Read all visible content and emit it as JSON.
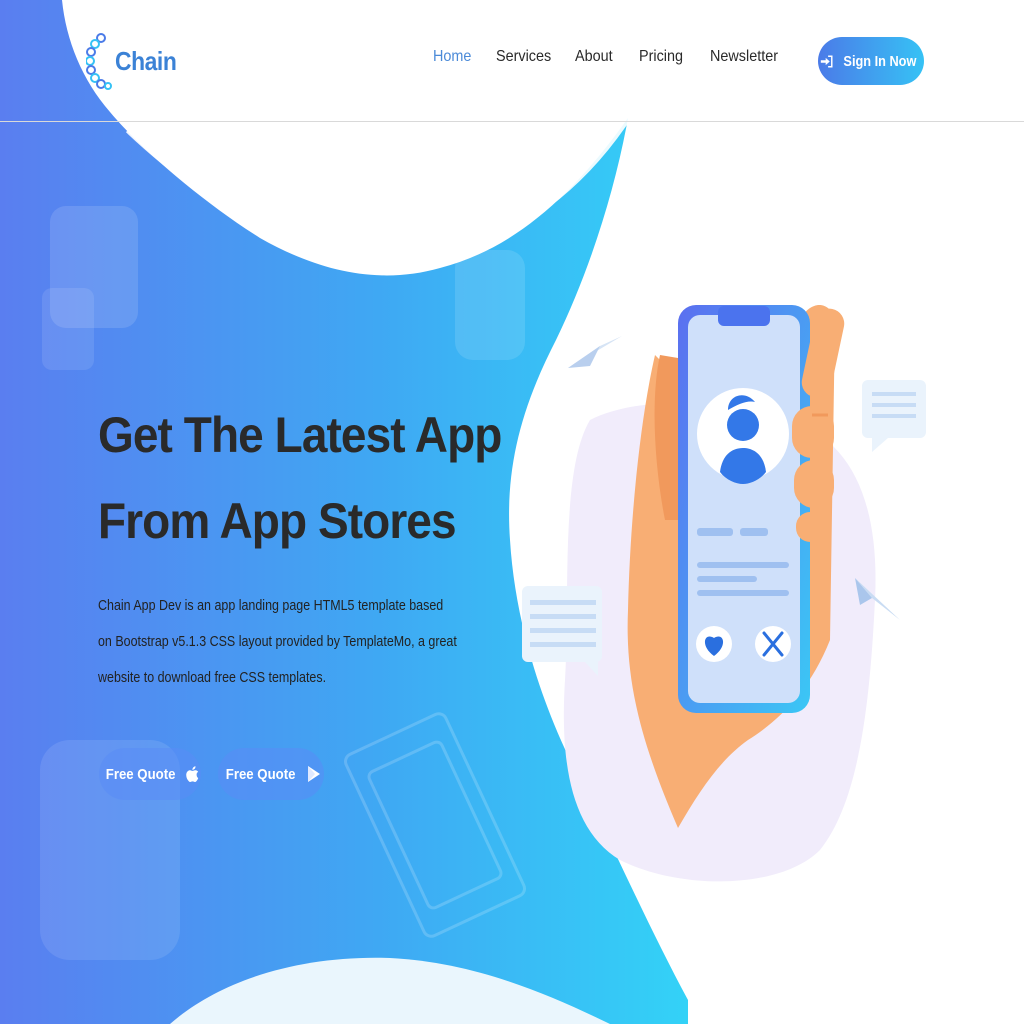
{
  "brand": {
    "name": "Chain"
  },
  "nav": {
    "items": [
      {
        "label": "Home",
        "active": true
      },
      {
        "label": "Services",
        "active": false
      },
      {
        "label": "About",
        "active": false
      },
      {
        "label": "Pricing",
        "active": false
      },
      {
        "label": "Newsletter",
        "active": false
      }
    ],
    "signin_label": "Sign In Now",
    "signin_icon": "sign-in-icon"
  },
  "hero": {
    "title_line1": "Get The Latest App",
    "title_line2": "From App Stores",
    "description": "Chain App Dev is an app landing page HTML5 template based on Bootstrap v5.1.3 CSS layout provided by TemplateMo, a great website to download free CSS templates.",
    "buttons": [
      {
        "label": "Free Quote",
        "icon": "apple-icon"
      },
      {
        "label": "Free Quote",
        "icon": "play-icon"
      }
    ]
  },
  "colors": {
    "accent_start": "#4b7be8",
    "accent_end": "#36c2f5",
    "active_nav": "#4b8ad8",
    "text_dark": "#2a2a2a"
  }
}
